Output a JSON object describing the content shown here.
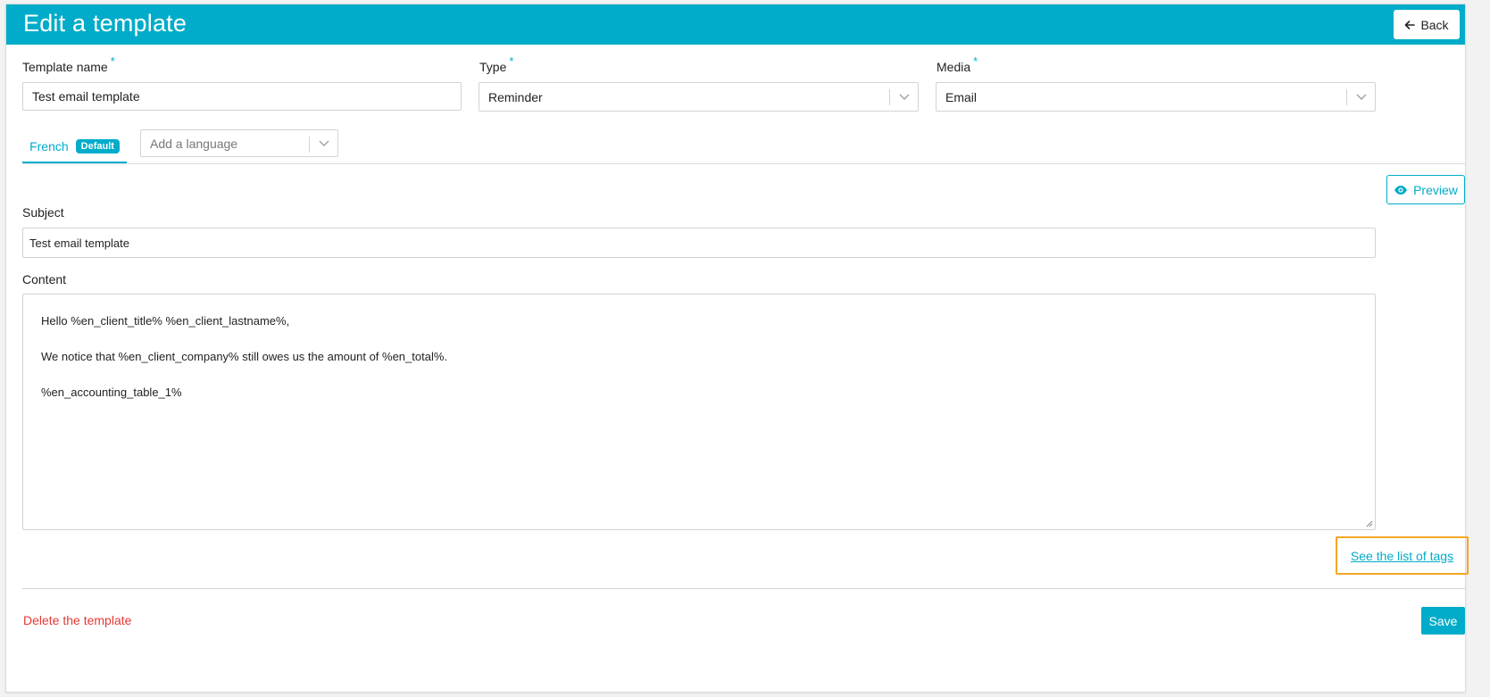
{
  "header": {
    "title": "Edit a template",
    "back_label": "Back"
  },
  "form": {
    "template_name": {
      "label": "Template name",
      "required_mark": "*",
      "value": "Test email template"
    },
    "type": {
      "label": "Type",
      "required_mark": "*",
      "value": "Reminder"
    },
    "media": {
      "label": "Media",
      "required_mark": "*",
      "value": "Email"
    }
  },
  "tabs": {
    "active": {
      "label": "French",
      "badge": "Default"
    },
    "add_language_placeholder": "Add a language"
  },
  "editor": {
    "preview_label": "Preview",
    "subject_label": "Subject",
    "subject_value": "Test email template",
    "content_label": "Content",
    "content_lines": [
      "Hello %en_client_title% %en_client_lastname%,",
      "We notice that %en_client_company% still owes us the amount of %en_total%.",
      "%en_accounting_table_1%"
    ],
    "tags_link": "See the list of tags"
  },
  "footer": {
    "delete_label": "Delete the template",
    "save_label": "Save"
  },
  "colors": {
    "accent": "#00acc9",
    "danger": "#e53935",
    "highlight": "#f5a623"
  }
}
